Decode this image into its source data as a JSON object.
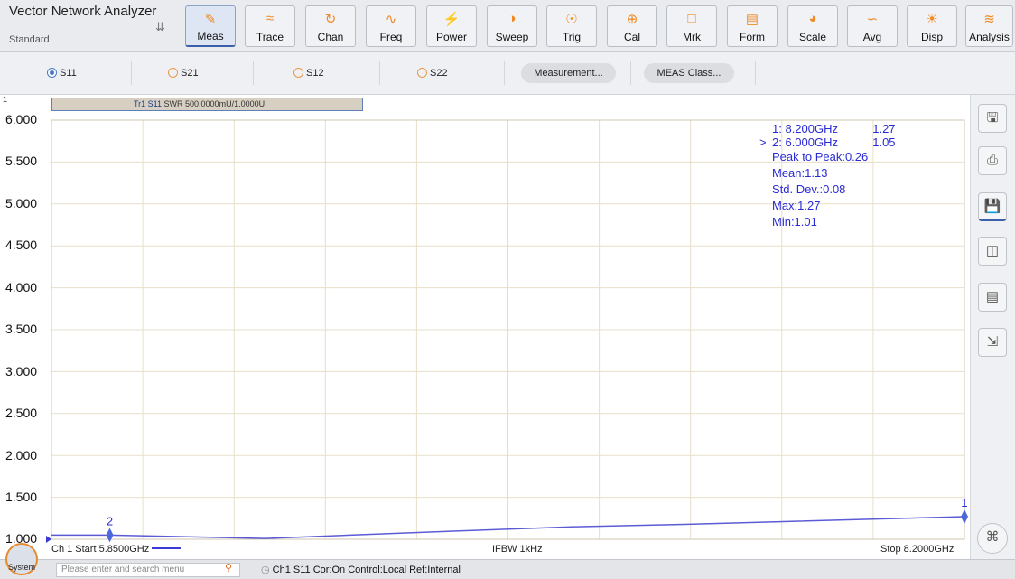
{
  "app": {
    "title": "Vector Network Analyzer",
    "subtitle": "Standard"
  },
  "toolbar": [
    {
      "label": "Meas",
      "icon": "ruler-icon",
      "active": true
    },
    {
      "label": "Trace",
      "icon": "trace-icon"
    },
    {
      "label": "Chan",
      "icon": "channel-icon"
    },
    {
      "label": "Freq",
      "icon": "frequency-icon"
    },
    {
      "label": "Power",
      "icon": "power-icon"
    },
    {
      "label": "Sweep",
      "icon": "sweep-icon"
    },
    {
      "label": "Trig",
      "icon": "trigger-icon"
    },
    {
      "label": "Cal",
      "icon": "calibration-icon"
    },
    {
      "label": "Mrk",
      "icon": "marker-icon"
    },
    {
      "label": "Form",
      "icon": "format-icon"
    },
    {
      "label": "Scale",
      "icon": "scale-icon"
    },
    {
      "label": "Avg",
      "icon": "average-icon"
    },
    {
      "label": "Disp",
      "icon": "display-icon"
    },
    {
      "label": "Analysis",
      "icon": "analysis-icon"
    }
  ],
  "sparams": [
    {
      "label": "S11",
      "selected": true
    },
    {
      "label": "S21"
    },
    {
      "label": "S12"
    },
    {
      "label": "S22"
    }
  ],
  "pills": {
    "measurement": "Measurement...",
    "meas_class": "MEAS Class..."
  },
  "trace": {
    "channel_number": "1",
    "title_bold": "Tr1 S11",
    "title_rest": "SWR 500.0000mU/1.0000U"
  },
  "markers": {
    "rows": [
      {
        "prefix": "",
        "id": "1",
        "freq": ": 8.200GHz",
        "value": "1.27"
      },
      {
        "prefix": "> ",
        "id": "2",
        "freq": ": 6.000GHz",
        "value": "1.05"
      }
    ],
    "stats": [
      "Peak to Peak:0.26",
      "Mean:1.13",
      "Std. Dev.:0.08",
      "Max:1.27",
      "Min:1.01"
    ],
    "marker2_label": "2"
  },
  "chart_data": {
    "type": "line",
    "ylim": [
      1.0,
      6.0
    ],
    "ytick_labels": [
      "6.000",
      "5.500",
      "5.000",
      "4.500",
      "4.000",
      "3.500",
      "3.000",
      "2.500",
      "2.000",
      "1.500",
      "1.000"
    ],
    "xlim": [
      5.85,
      8.2
    ],
    "x": [
      5.85,
      6.0,
      6.4,
      6.9,
      7.2,
      7.5,
      8.2
    ],
    "series": [
      {
        "values": [
          1.05,
          1.05,
          1.01,
          1.1,
          1.15,
          1.18,
          1.27
        ]
      }
    ],
    "marker_points": [
      {
        "id": "1",
        "x": 8.2,
        "y": 1.27
      },
      {
        "id": "2",
        "x": 6.0,
        "y": 1.05
      }
    ],
    "line_color": "#5b5bd6"
  },
  "footer": {
    "start": "Ch 1 Start 5.8500GHz",
    "ifbw": "IFBW 1kHz",
    "stop": "Stop 8.2000GHz"
  },
  "status": {
    "system": "System",
    "search_placeholder": "Please enter and search menu",
    "info": "Ch1 S11 Cor:On Control:Local Ref:Internal"
  },
  "sidebar_icons": [
    "save-icon",
    "print-icon",
    "save-as-icon",
    "recall-icon",
    "image-export-icon",
    "shrink-icon",
    "collapse-icon"
  ]
}
